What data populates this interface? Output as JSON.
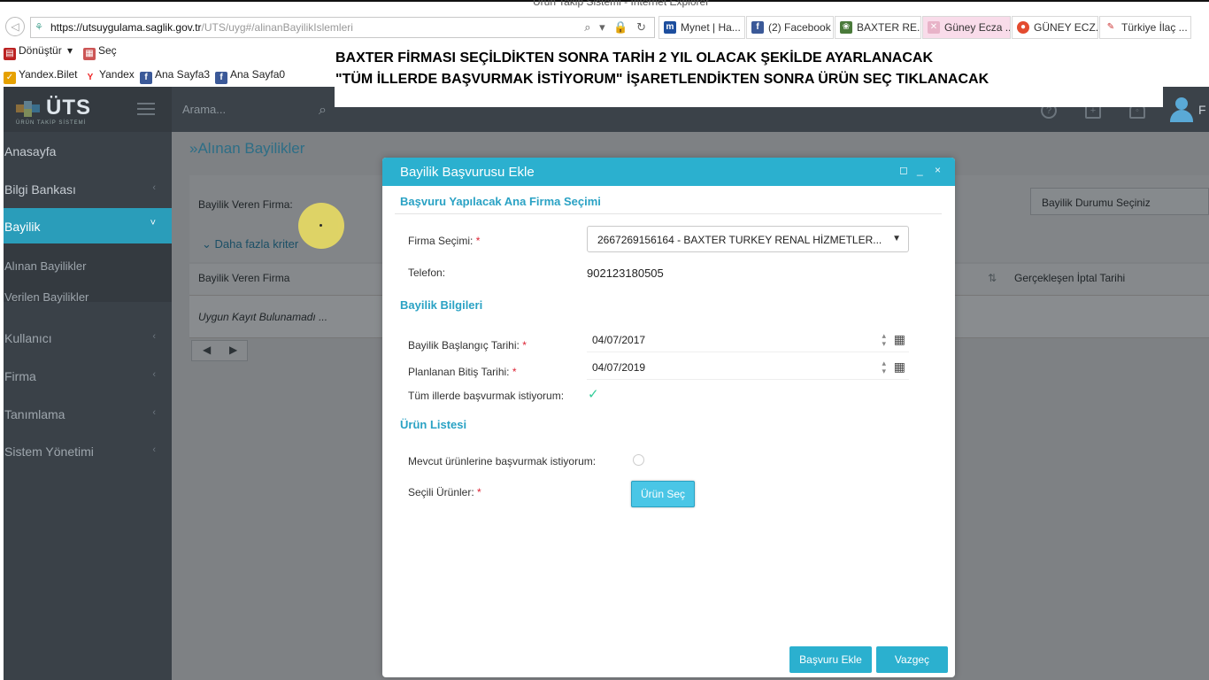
{
  "window": {
    "title": "Ürün Takip Sistemi - Internet Explorer"
  },
  "browser": {
    "url_prefix": "https://utsuygulama.",
    "url_domain": "saglik.gov.tr",
    "url_path": "/UTS/uyg#/alinanBayilikIslemleri",
    "addr_tools": "⌕ ▾ 🔒 ↻",
    "tabs": [
      {
        "label": "Mynet | Ha...",
        "icon": "m",
        "color": "#1d4e9e"
      },
      {
        "label": "(2) Facebook",
        "icon": "f",
        "color": "#3b5998"
      },
      {
        "label": "BAXTER RE...",
        "icon": "❀",
        "color": "#4a7a3a"
      },
      {
        "label": "Güney Ecza ...",
        "icon": "✕",
        "color": "#e8b3c8"
      },
      {
        "label": "GÜNEY ECZ...",
        "icon": "●",
        "color": "#e34b2f"
      },
      {
        "label": "Türkiye İlaç ...",
        "icon": "✎",
        "color": "#c33"
      }
    ],
    "toolbar": [
      {
        "label": "Dönüştür",
        "icon": "▤",
        "color": "#b22"
      },
      {
        "label": "▾",
        "icon": "",
        "color": ""
      },
      {
        "label": "Seç",
        "icon": "▦",
        "color": "#c55"
      }
    ],
    "favorites": [
      {
        "label": "Yandex.Bilet",
        "icon": "✓",
        "color": "#e6a100"
      },
      {
        "label": "Yandex",
        "icon": "Y",
        "color": "#e22"
      },
      {
        "label": "Ana Sayfa3",
        "icon": "f",
        "color": "#3b5998"
      },
      {
        "label": "Ana Sayfa0",
        "icon": "f",
        "color": "#3b5998"
      }
    ]
  },
  "annotation": {
    "line1": "BAXTER FİRMASI SEÇİLDİKTEN SONRA TARİH 2 YIL OLACAK ŞEKİLDE AYARLANACAK",
    "line2": "\"TÜM İLLERDE BAŞVURMAK İSTİYORUM\" İŞARETLENDİKTEN SONRA ÜRÜN SEÇ TIKLANACAK"
  },
  "app": {
    "logo": "ÜTS",
    "logo_sub": "ÜRÜN TAKİP SİSTEMİ",
    "search_placeholder": "Arama...",
    "user_initial": "F",
    "sidebar": [
      {
        "label": "Anasayfa",
        "chevron": ""
      },
      {
        "label": "Bilgi Bankası",
        "chevron": "‹"
      },
      {
        "label": "Bayilik",
        "chevron": "˅"
      },
      {
        "label": "Alınan Bayilikler",
        "chevron": ""
      },
      {
        "label": "Verilen Bayilikler",
        "chevron": ""
      },
      {
        "label": "Kullanıcı",
        "chevron": "‹"
      },
      {
        "label": "Firma",
        "chevron": "‹"
      },
      {
        "label": "Tanımlama",
        "chevron": "‹"
      },
      {
        "label": "Sistem Yönetimi",
        "chevron": "‹"
      }
    ],
    "page_title": "»Alınan Bayilikler",
    "filter_label": "Bayilik Veren Firma:",
    "more_criteria": "Daha fazla kriter",
    "status_select": "Bayilik Durumu Seçiniz",
    "grid_columns": [
      "Bayilik Veren Firma",
      "Gerçekleşen İptal Tarihi"
    ],
    "grid_empty": "Uygun Kayıt Bulunamadı ..."
  },
  "modal": {
    "title": "Bayilik Başvurusu Ekle",
    "section_firm": "Başvuru Yapılacak Ana Firma Seçimi",
    "firm_label": "Firma Seçimi:",
    "firm_value": "2667269156164 - BAXTER TURKEY RENAL HİZMETLER...",
    "phone_label": "Telefon:",
    "phone_value": "902123180505",
    "section_dealer": "Bayilik Bilgileri",
    "start_label": "Bayilik Başlangıç Tarihi:",
    "start_value": "04/07/2017",
    "end_label": "Planlanan Bitiş Tarihi:",
    "end_value": "04/07/2019",
    "all_cities_label": "Tüm illerde başvurmak istiyorum:",
    "all_cities_checked": true,
    "section_products": "Ürün Listesi",
    "existing_label": "Mevcut ürünlerine başvurmak istiyorum:",
    "selected_label": "Seçili Ürünler:",
    "select_product_button": "Ürün Seç",
    "submit_button": "Başvuru Ekle",
    "cancel_button": "Vazgeç"
  }
}
